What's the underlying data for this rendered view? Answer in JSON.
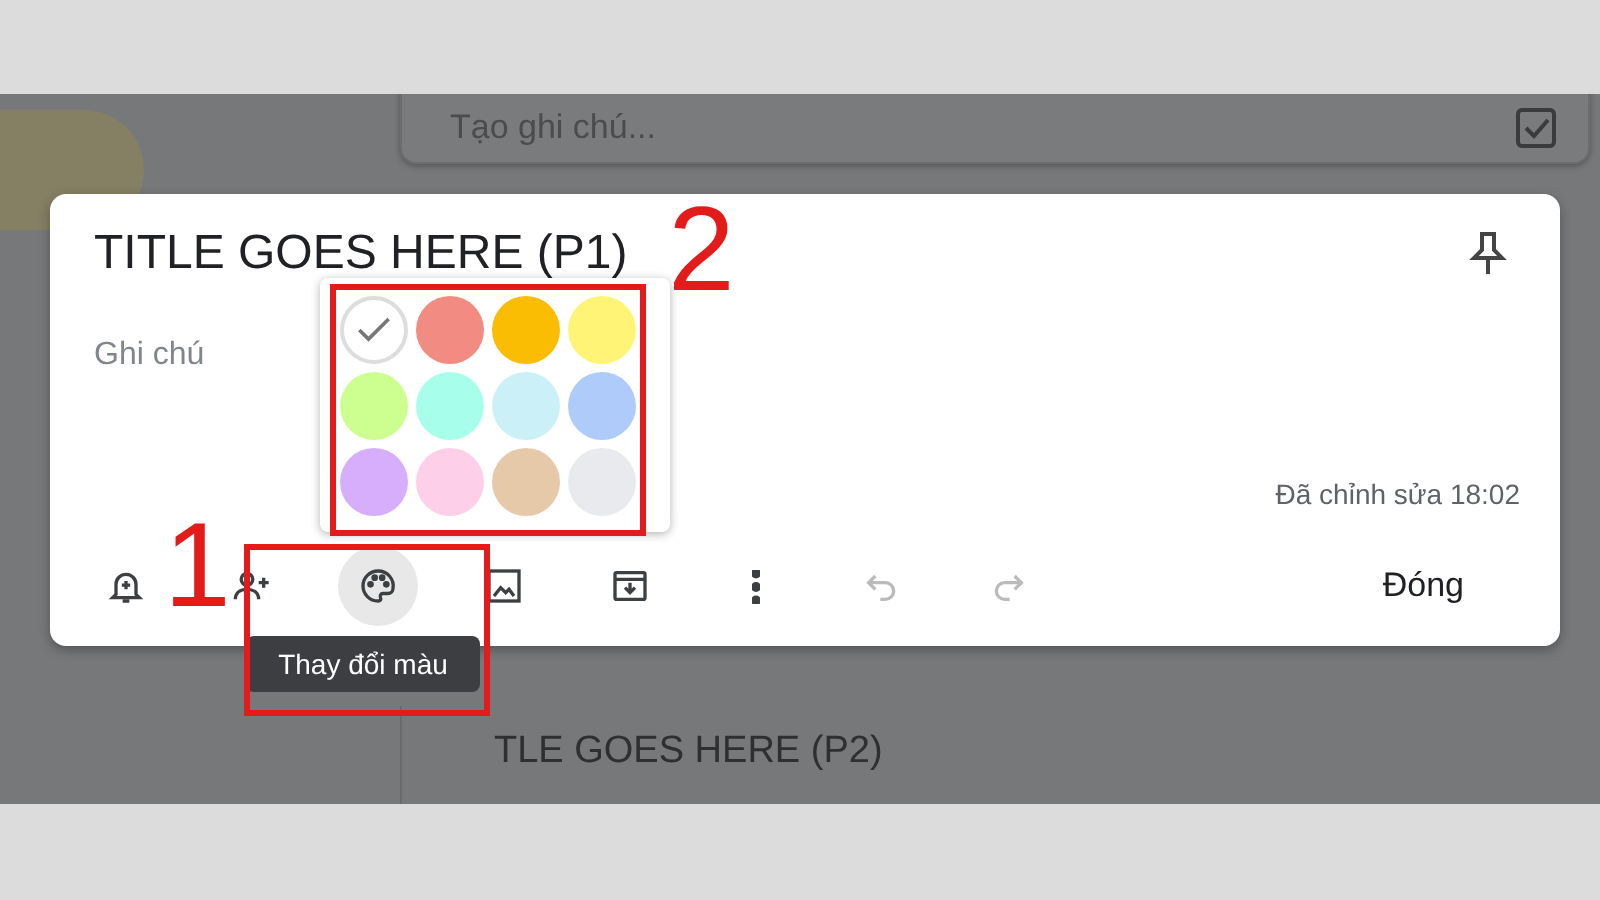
{
  "background": {
    "create_note": {
      "placeholder": "Tạo ghi chú..."
    },
    "note_title": "TLE GOES HERE (P2)"
  },
  "note": {
    "title": "TITLE GOES HERE (P1)",
    "placeholder": "Ghi chú",
    "edited": "Đã chỉnh sửa 18:02",
    "close": "Đóng"
  },
  "toolbar": [
    {
      "kind": "reminder",
      "disabled": false,
      "highlighted": false
    },
    {
      "kind": "collaborator",
      "disabled": false,
      "highlighted": false
    },
    {
      "kind": "color",
      "disabled": false,
      "highlighted": true
    },
    {
      "kind": "image",
      "disabled": false,
      "highlighted": false
    },
    {
      "kind": "archive",
      "disabled": false,
      "highlighted": false
    },
    {
      "kind": "more",
      "disabled": false,
      "highlighted": false
    },
    {
      "kind": "undo",
      "disabled": true,
      "highlighted": false
    },
    {
      "kind": "redo",
      "disabled": true,
      "highlighted": false
    }
  ],
  "tooltip": "Thay đổi màu",
  "palette": [
    {
      "color": "#ffffff",
      "selected": true
    },
    {
      "color": "#f28b82",
      "selected": false
    },
    {
      "color": "#fbbc04",
      "selected": false
    },
    {
      "color": "#fff475",
      "selected": false
    },
    {
      "color": "#ccff90",
      "selected": false
    },
    {
      "color": "#a7ffeb",
      "selected": false
    },
    {
      "color": "#cbf0f8",
      "selected": false
    },
    {
      "color": "#aecbfa",
      "selected": false
    },
    {
      "color": "#d7aefb",
      "selected": false
    },
    {
      "color": "#fdcfe8",
      "selected": false
    },
    {
      "color": "#e6c9a8",
      "selected": false
    },
    {
      "color": "#e8eaed",
      "selected": false
    }
  ],
  "annotations": [
    {
      "label": "1"
    },
    {
      "label": "2"
    }
  ]
}
